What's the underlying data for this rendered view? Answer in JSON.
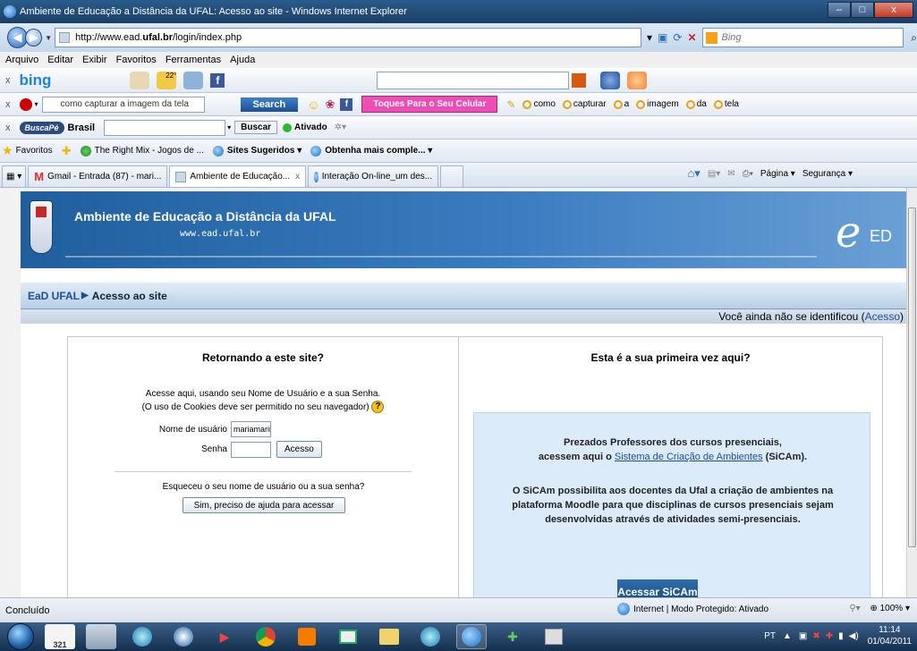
{
  "window": {
    "title": "Ambiente de Educação a Distância da UFAL: Acesso ao site - Windows Internet Explorer",
    "controls": {
      "minimize": "–",
      "maximize": "□",
      "close": "x"
    }
  },
  "address": {
    "url_prefix": "http://www.ead.",
    "url_domain": "ufal.br",
    "url_path": "/login/index.php",
    "search_placeholder": "Bing"
  },
  "menu": [
    "Arquivo",
    "Editar",
    "Exibir",
    "Favoritos",
    "Ferramentas",
    "Ajuda"
  ],
  "toolbar_bing": {
    "close": "x",
    "logo": "bing",
    "weather": "22°"
  },
  "toolbar_search": {
    "close": "x",
    "query": "como capturar a imagem da tela",
    "search_label": "Search",
    "pink_label": "Toques Para o Seu Celular",
    "chips": [
      "como",
      "capturar",
      "a",
      "imagem",
      "da",
      "tela"
    ]
  },
  "toolbar_buscape": {
    "close": "x",
    "logo": "BuscaPé",
    "region": "Brasil",
    "buscar_label": "Buscar",
    "ativado_label": "Ativado"
  },
  "favorites": {
    "label": "Favoritos",
    "items": [
      "The Right Mix - Jogos de ...",
      "Sites Sugeridos ▾",
      "Obtenha mais comple... ▾"
    ]
  },
  "tabs": [
    {
      "label": "Gmail - Entrada (87) - mari..."
    },
    {
      "label": "Ambiente de Educação...",
      "close": "x"
    },
    {
      "label": "Interação On-line_um des..."
    }
  ],
  "commandbar": {
    "page": "Página ▾",
    "security": "Segurança ▾"
  },
  "site": {
    "title": "Ambiente de Educação a Distância da UFAL",
    "url": "www.ead.ufal.br",
    "logo_e": "e",
    "logo_ed": "ED",
    "breadcrumb_home": "EaD UFAL",
    "breadcrumb_current": "Acesso ao site",
    "login_status_prefix": "Você ainda não se identificou (",
    "login_status_link": "Acesso",
    "login_status_suffix": ")"
  },
  "login": {
    "returning_title": "Retornando a este site?",
    "desc_line1": "Acesse aqui, usando seu Nome de Usuário e a sua Senha.",
    "desc_line2": "(O uso de Cookies deve ser permitido no seu navegador)",
    "username_label": "Nome de usuário",
    "username_value": "mariamarinho",
    "password_label": "Senha",
    "submit_label": "Acesso",
    "forgot_text": "Esqueceu o seu nome de usuário ou a sua senha?",
    "forgot_button": "Sim, preciso de ajuda para acessar"
  },
  "firsttime": {
    "title": "Esta é a sua primeira vez aqui?",
    "p1_line1": "Prezados Professores dos cursos presenciais,",
    "p1_line2_prefix": "acessem aqui o ",
    "p1_link": "Sistema de Criação de Ambientes",
    "p1_line2_suffix": " (SiCAm).",
    "p2_line1": "O SiCAm possibilita aos docentes da Ufal a criação de ambientes na",
    "p2_line2": "plataforma Moodle para que disciplinas de cursos presenciais sejam",
    "p2_line3": "desenvolvidas através de atividades semi-presenciais.",
    "button": "Acessar SiCAm"
  },
  "status": {
    "left": "Concluído",
    "zone": "Internet | Modo Protegido: Ativado",
    "zoom": "100%"
  },
  "taskbar": {
    "calendar": "321",
    "lang": "PT",
    "time": "11:14",
    "date": "01/04/2011"
  }
}
